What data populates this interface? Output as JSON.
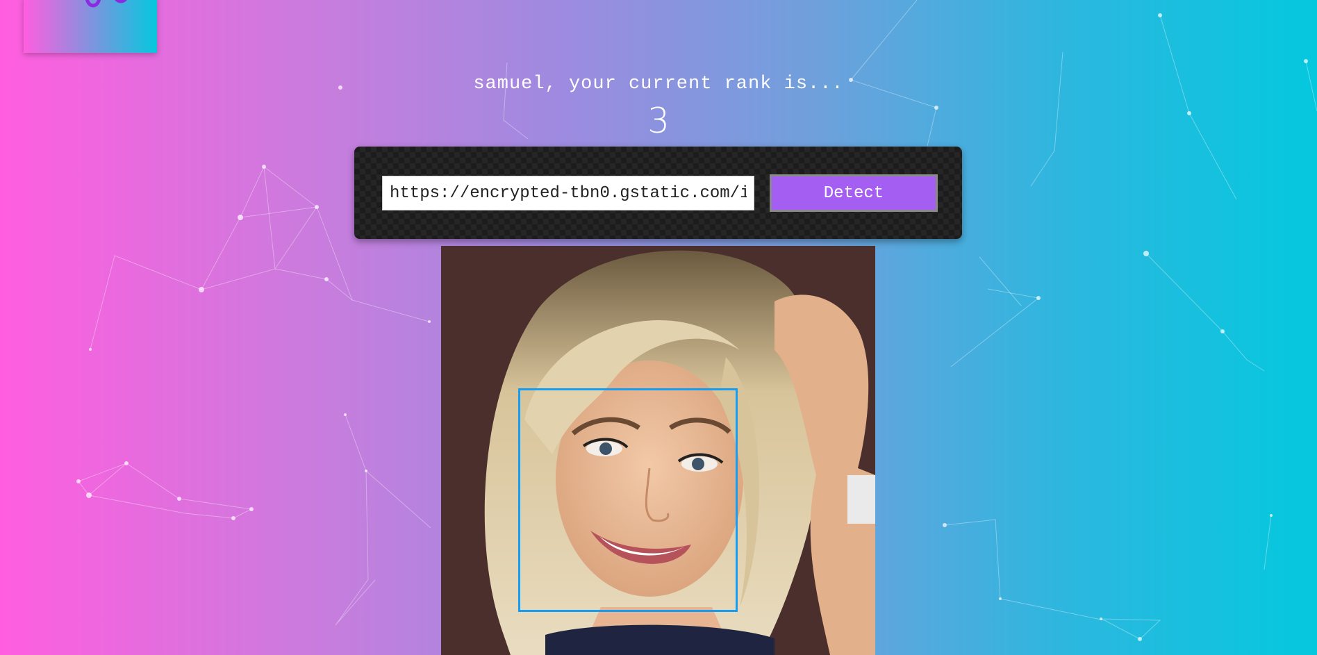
{
  "header": {
    "greeting": "samuel, your current rank is...",
    "rank": "3"
  },
  "form": {
    "url_value": "https://encrypted-tbn0.gstatic.com/i",
    "detect_label": "Detect"
  },
  "result": {
    "faces_detected": 1
  },
  "colors": {
    "gradient_left": "#ff5edf",
    "gradient_right": "#04c8de",
    "button": "#a45ef2",
    "face_box": "#149df2"
  }
}
